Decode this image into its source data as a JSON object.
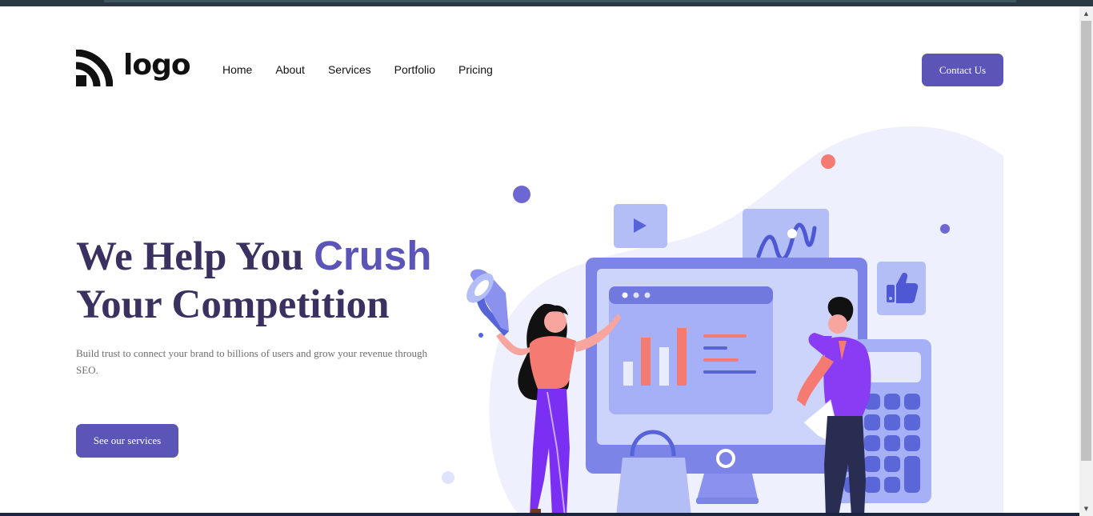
{
  "header": {
    "logo_text": "logo",
    "nav": [
      {
        "label": "Home"
      },
      {
        "label": "About"
      },
      {
        "label": "Services"
      },
      {
        "label": "Portfolio"
      },
      {
        "label": "Pricing"
      }
    ],
    "contact_label": "Contact Us"
  },
  "hero": {
    "title_part1": "We Help You ",
    "title_accent": "Crush",
    "title_part2": "Your Competition",
    "description": "Build trust to connect your brand to billions of users and grow your revenue through SEO.",
    "cta_label": "See our services"
  },
  "colors": {
    "accent": "#5c55b8",
    "title": "#3a3160",
    "illustration_light": "#b8c0f5",
    "illustration_blob": "#eef1fd",
    "coral": "#f47a72"
  },
  "icons": {
    "logo": "logo-mark-icon",
    "video": "play-icon",
    "wave": "wave-chart-icon",
    "like": "thumbs-up-icon",
    "megaphone": "megaphone-icon"
  }
}
